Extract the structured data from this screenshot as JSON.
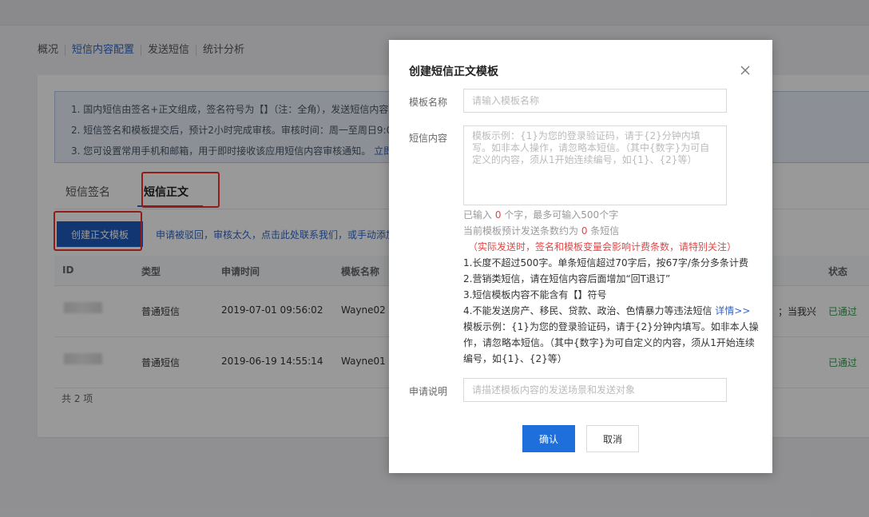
{
  "nav": {
    "tabs": [
      {
        "label": "概况"
      },
      {
        "label": "短信内容配置"
      },
      {
        "label": "发送短信"
      },
      {
        "label": "统计分析"
      }
    ]
  },
  "notice": {
    "line1": "1. 国内短信由签名+正文组成，签名符号为【】（注：全角），发送短信内容",
    "line2": "2. 短信签名和模板提交后，预计2小时完成审核。审核时间：周一至周日9:00",
    "line3": "3. 您可设置常用手机和邮箱，用于即时接收该应用短信内容审核通知。",
    "line3_link": "立即"
  },
  "sub_tabs": [
    {
      "label": "短信签名"
    },
    {
      "label": "短信正文"
    }
  ],
  "toolbar": {
    "create_label": "创建正文模板",
    "hint": "申请被驳回，审核太久，点击此处联系我们，或手动添加"
  },
  "table": {
    "headers": {
      "id": "ID",
      "type": "类型",
      "time": "申请时间",
      "name": "模板名称",
      "status": "状态"
    },
    "rows": [
      {
        "type": "普通短信",
        "time": "2019-07-01 09:56:02",
        "name": "Wayne02",
        "extra": "；当我兴",
        "status": "已通过"
      },
      {
        "type": "普通短信",
        "time": "2019-06-19 14:55:14",
        "name": "Wayne01",
        "extra": "",
        "status": "已通过"
      }
    ],
    "total": "共 2 项"
  },
  "modal": {
    "title": "创建短信正文模板",
    "name_label": "模板名称",
    "name_placeholder": "请输入模板名称",
    "content_label": "短信内容",
    "content_placeholder": "模板示例：{1}为您的登录验证码，请于{2}分钟内填写。如非本人操作，请忽略本短信。（其中{数字}为可自定义的内容，须从1开始连续编号，如{1}、{2}等）",
    "count_prefix": "已输入 ",
    "count_value": "0",
    "count_suffix": " 个字，最多可输入500个字",
    "estimate_prefix": "当前模板预计发送条数约为 ",
    "estimate_value": "0",
    "estimate_suffix": " 条短信",
    "warning": "（实际发送时，签名和模板变量会影响计费条数，请特别关注）",
    "rules": [
      "1.长度不超过500字。单条短信超过70字后，按67字/条分多条计费",
      "2.营销类短信，请在短信内容后面增加“回T退订”",
      "3.短信模板内容不能含有【】符号",
      "4.不能发送房产、移民、贷款、政治、色情暴力等违法短信"
    ],
    "rules_link": "详情>>",
    "example": "模板示例：{1}为您的登录验证码，请于{2}分钟内填写。如非本人操作，请忽略本短信。（其中{数字}为可自定义的内容，须从1开始连续编号，如{1}、{2}等）",
    "desc_label": "申请说明",
    "desc_placeholder": "请描述模板内容的发送场景和发送对象",
    "confirm_label": "确认",
    "cancel_label": "取消"
  },
  "colors": {
    "primary": "#1e6fdc",
    "annotation": "#f0312a",
    "success": "#2e9e49",
    "warning": "#e54545"
  }
}
